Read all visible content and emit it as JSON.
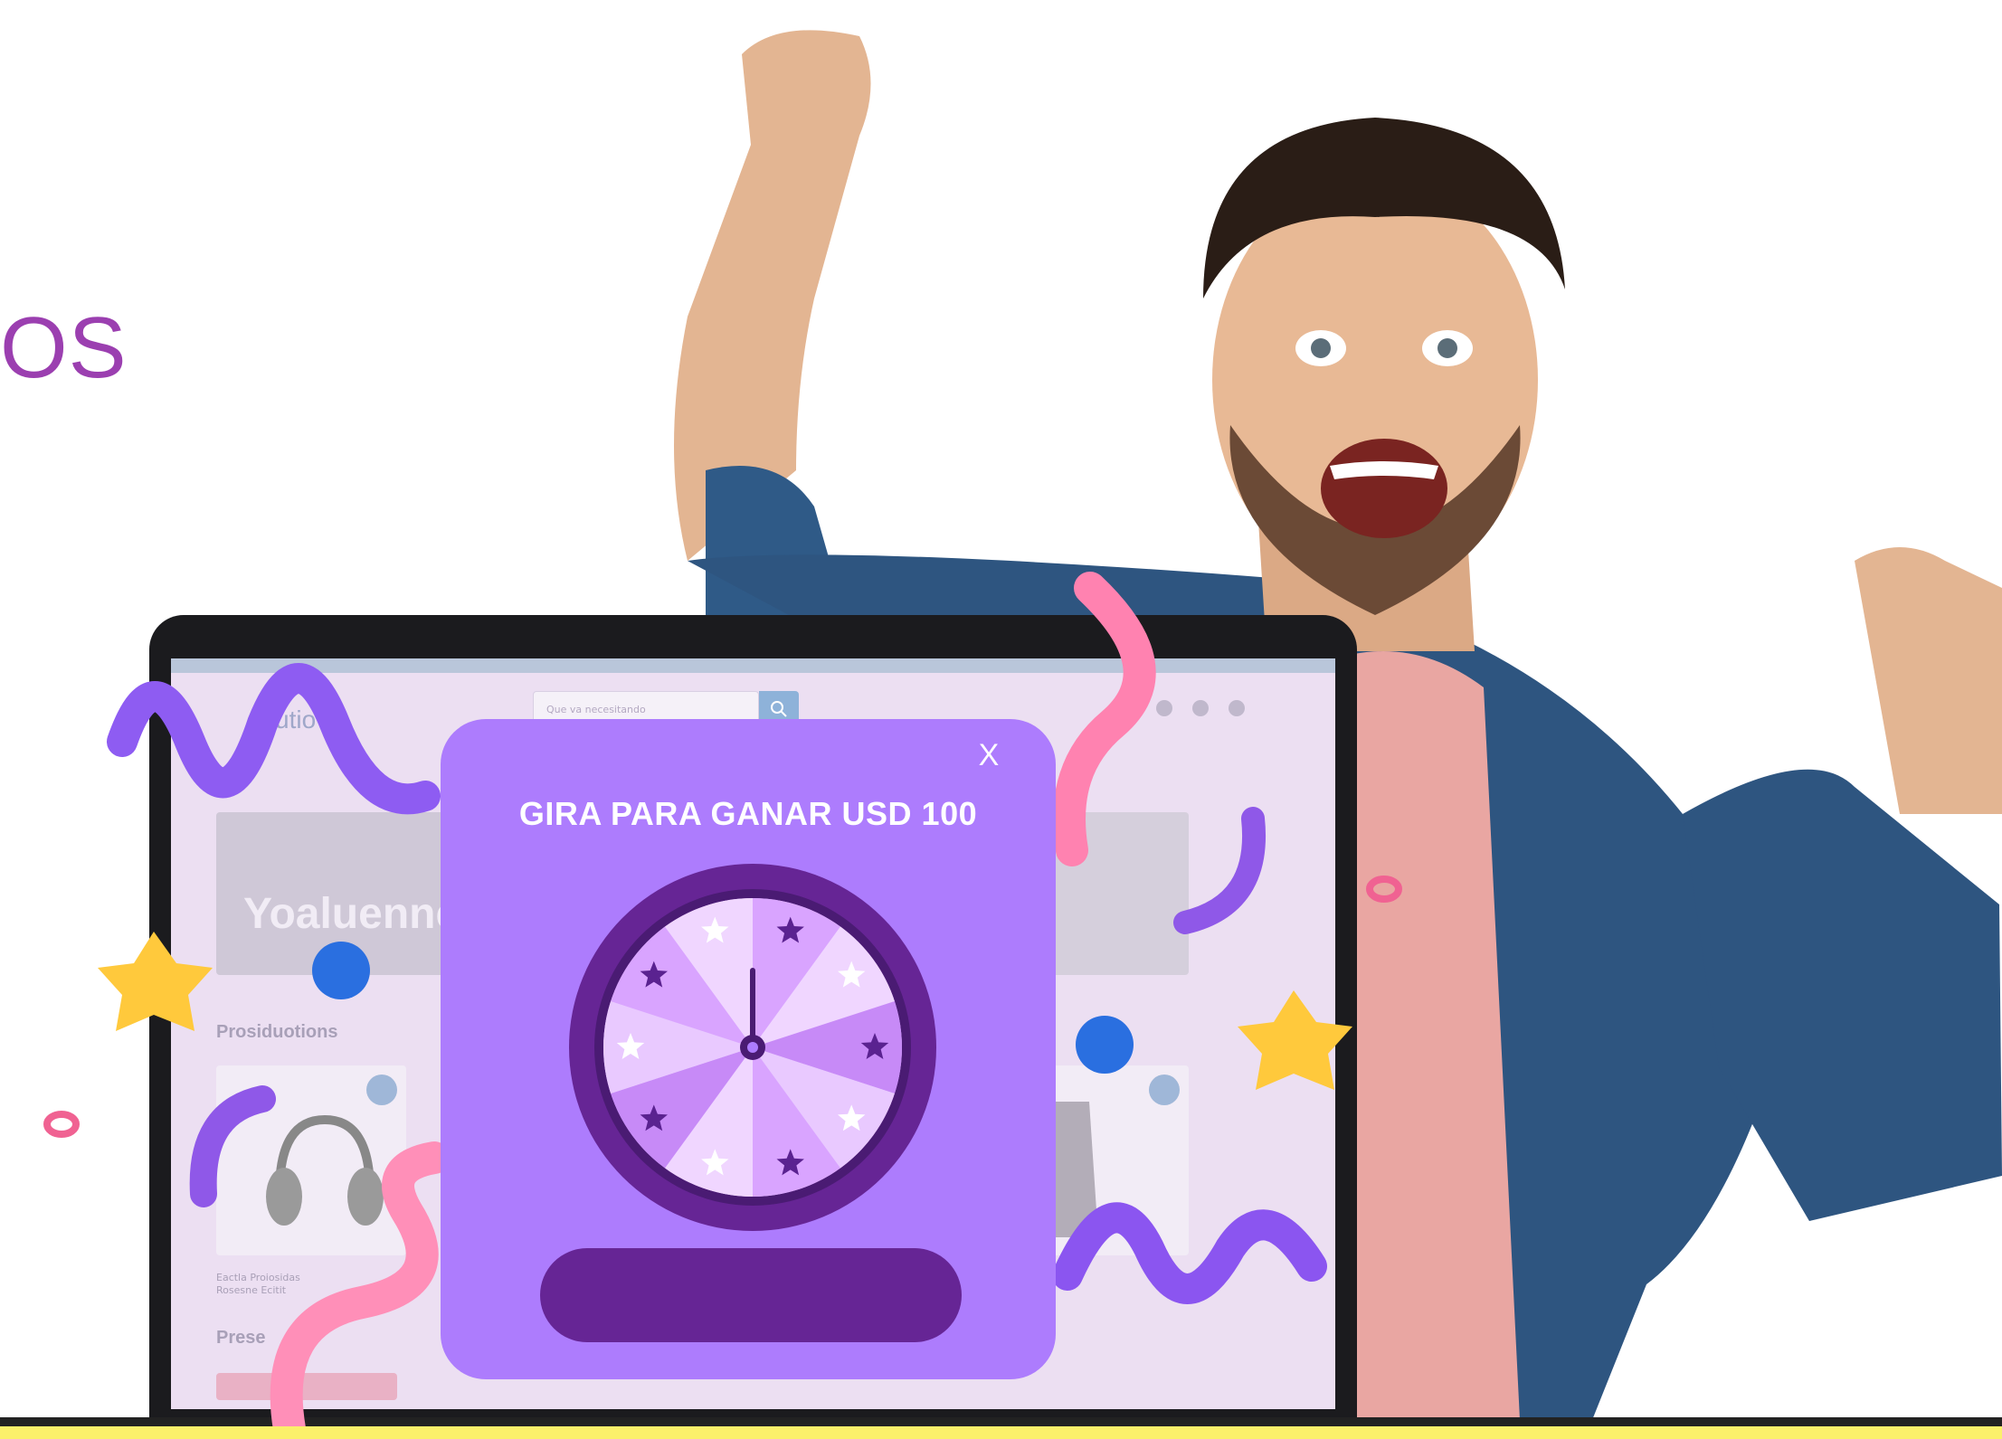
{
  "headline": {
    "text": "OS"
  },
  "laptop_site": {
    "logo_text": "utio",
    "search_placeholder": "Que va necesitando",
    "hero_text": "Yoaluenne",
    "section_products": "Prosiduotions",
    "section_second": "Prese",
    "product_caption_1": "Eactla Proiosidas",
    "product_caption_2": "Rosesne Ecitit"
  },
  "popup": {
    "close_label": "X",
    "title": "GIRA PARA GANAR USD 100",
    "button_label": ""
  },
  "colors": {
    "popup_bg": "#ad7cfd",
    "button_bg": "#662595",
    "headline": "#9b3fb0",
    "band": "#fbf06a"
  }
}
